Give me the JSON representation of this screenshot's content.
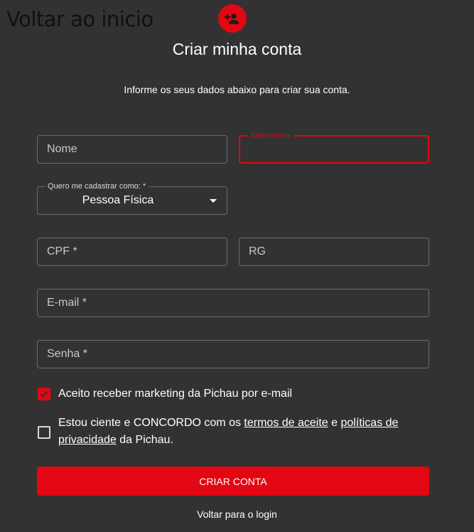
{
  "header": {
    "back_home_label": "Voltar ao inicio",
    "title": "Criar minha conta",
    "subtitle": "Informe os seus dados abaixo para criar sua conta.",
    "avatar_icon": "person-add-icon"
  },
  "form": {
    "nome": {
      "placeholder": "Nome"
    },
    "sobrenome": {
      "label": "Sobrenome",
      "value": ""
    },
    "tipo_cadastro": {
      "label": "Quero me cadastrar como: *",
      "selected": "Pessoa Física"
    },
    "cpf": {
      "placeholder": "CPF *"
    },
    "rg": {
      "placeholder": "RG"
    },
    "email": {
      "placeholder": "E-mail *"
    },
    "senha": {
      "placeholder": "Senha *"
    }
  },
  "checkboxes": {
    "marketing": {
      "label": "Aceito receber marketing da Pichau por e-mail",
      "checked": true
    },
    "terms": {
      "checked": false,
      "prefix": "Estou ciente e CONCORDO com os ",
      "terms_link": "termos de aceite",
      "middle": " e ",
      "privacy_link_line1": "políticas de",
      "privacy_link_line2": "privacidade",
      "suffix": " da Pichau."
    }
  },
  "actions": {
    "submit_label": "CRIAR CONTA",
    "back_login_label": "Voltar para o login"
  },
  "colors": {
    "accent": "#e30613",
    "background": "#323232",
    "border": "#6b6b6b"
  }
}
